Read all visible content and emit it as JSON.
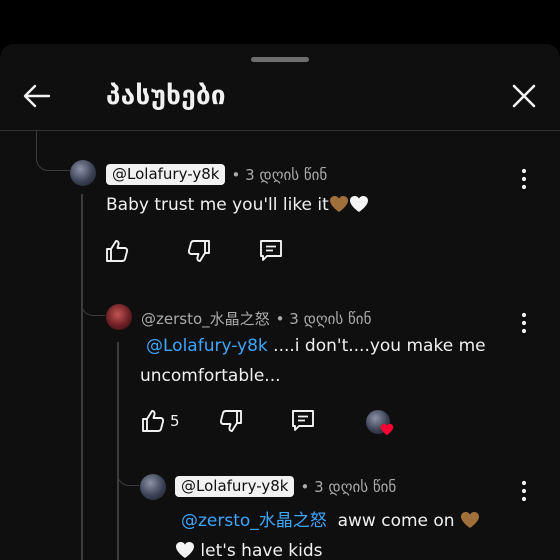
{
  "header": {
    "title": "პასუხები"
  },
  "comments": [
    {
      "author": "@Lolafury-y8k",
      "time": "3 დღის წინ",
      "text": "Baby trust me you'll like it",
      "likes": ""
    },
    {
      "author": "@zersto_水晶之怒",
      "time": "3 დღის წინ",
      "mention": "@Lolafury-y8k",
      "text_line1": " ....i don't....you make me",
      "text_line2": "uncomfortable...",
      "likes": "5"
    },
    {
      "author": "@Lolafury-y8k",
      "time": "3 დღის წინ",
      "mention": "@zersto_水晶之怒",
      "text_line1": "  aww come on ",
      "text_line2": " let's have kids"
    }
  ],
  "separator": "•",
  "icons": {
    "back": "arrow-left-icon",
    "close": "close-icon",
    "like": "thumbs-up-icon",
    "dislike": "thumbs-down-icon",
    "reply": "reply-comment-icon",
    "more": "more-vertical-icon",
    "heart": "creator-heart-icon"
  },
  "colors": {
    "background": "#0f0f0f",
    "mention": "#3ea6ff",
    "chip": "#f1f1f1",
    "secondary_text": "#aaaaaa",
    "heart": "#ff0033"
  }
}
